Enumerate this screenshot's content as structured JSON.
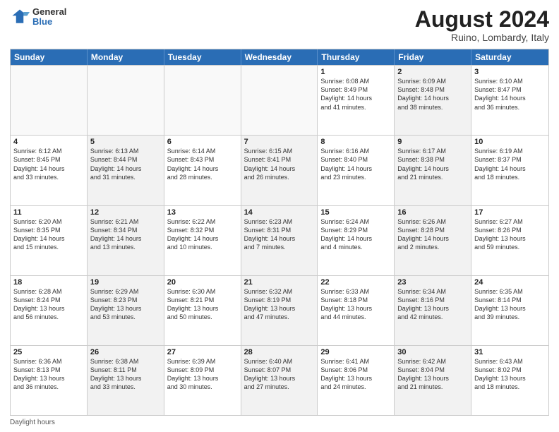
{
  "header": {
    "logo_general": "General",
    "logo_blue": "Blue",
    "main_title": "August 2024",
    "subtitle": "Ruino, Lombardy, Italy"
  },
  "calendar": {
    "days_of_week": [
      "Sunday",
      "Monday",
      "Tuesday",
      "Wednesday",
      "Thursday",
      "Friday",
      "Saturday"
    ],
    "weeks": [
      [
        {
          "day": "",
          "info": "",
          "shaded": false,
          "empty": true
        },
        {
          "day": "",
          "info": "",
          "shaded": false,
          "empty": true
        },
        {
          "day": "",
          "info": "",
          "shaded": false,
          "empty": true
        },
        {
          "day": "",
          "info": "",
          "shaded": false,
          "empty": true
        },
        {
          "day": "1",
          "info": "Sunrise: 6:08 AM\nSunset: 8:49 PM\nDaylight: 14 hours\nand 41 minutes.",
          "shaded": false,
          "empty": false
        },
        {
          "day": "2",
          "info": "Sunrise: 6:09 AM\nSunset: 8:48 PM\nDaylight: 14 hours\nand 38 minutes.",
          "shaded": true,
          "empty": false
        },
        {
          "day": "3",
          "info": "Sunrise: 6:10 AM\nSunset: 8:47 PM\nDaylight: 14 hours\nand 36 minutes.",
          "shaded": false,
          "empty": false
        }
      ],
      [
        {
          "day": "4",
          "info": "Sunrise: 6:12 AM\nSunset: 8:45 PM\nDaylight: 14 hours\nand 33 minutes.",
          "shaded": false,
          "empty": false
        },
        {
          "day": "5",
          "info": "Sunrise: 6:13 AM\nSunset: 8:44 PM\nDaylight: 14 hours\nand 31 minutes.",
          "shaded": true,
          "empty": false
        },
        {
          "day": "6",
          "info": "Sunrise: 6:14 AM\nSunset: 8:43 PM\nDaylight: 14 hours\nand 28 minutes.",
          "shaded": false,
          "empty": false
        },
        {
          "day": "7",
          "info": "Sunrise: 6:15 AM\nSunset: 8:41 PM\nDaylight: 14 hours\nand 26 minutes.",
          "shaded": true,
          "empty": false
        },
        {
          "day": "8",
          "info": "Sunrise: 6:16 AM\nSunset: 8:40 PM\nDaylight: 14 hours\nand 23 minutes.",
          "shaded": false,
          "empty": false
        },
        {
          "day": "9",
          "info": "Sunrise: 6:17 AM\nSunset: 8:38 PM\nDaylight: 14 hours\nand 21 minutes.",
          "shaded": true,
          "empty": false
        },
        {
          "day": "10",
          "info": "Sunrise: 6:19 AM\nSunset: 8:37 PM\nDaylight: 14 hours\nand 18 minutes.",
          "shaded": false,
          "empty": false
        }
      ],
      [
        {
          "day": "11",
          "info": "Sunrise: 6:20 AM\nSunset: 8:35 PM\nDaylight: 14 hours\nand 15 minutes.",
          "shaded": false,
          "empty": false
        },
        {
          "day": "12",
          "info": "Sunrise: 6:21 AM\nSunset: 8:34 PM\nDaylight: 14 hours\nand 13 minutes.",
          "shaded": true,
          "empty": false
        },
        {
          "day": "13",
          "info": "Sunrise: 6:22 AM\nSunset: 8:32 PM\nDaylight: 14 hours\nand 10 minutes.",
          "shaded": false,
          "empty": false
        },
        {
          "day": "14",
          "info": "Sunrise: 6:23 AM\nSunset: 8:31 PM\nDaylight: 14 hours\nand 7 minutes.",
          "shaded": true,
          "empty": false
        },
        {
          "day": "15",
          "info": "Sunrise: 6:24 AM\nSunset: 8:29 PM\nDaylight: 14 hours\nand 4 minutes.",
          "shaded": false,
          "empty": false
        },
        {
          "day": "16",
          "info": "Sunrise: 6:26 AM\nSunset: 8:28 PM\nDaylight: 14 hours\nand 2 minutes.",
          "shaded": true,
          "empty": false
        },
        {
          "day": "17",
          "info": "Sunrise: 6:27 AM\nSunset: 8:26 PM\nDaylight: 13 hours\nand 59 minutes.",
          "shaded": false,
          "empty": false
        }
      ],
      [
        {
          "day": "18",
          "info": "Sunrise: 6:28 AM\nSunset: 8:24 PM\nDaylight: 13 hours\nand 56 minutes.",
          "shaded": false,
          "empty": false
        },
        {
          "day": "19",
          "info": "Sunrise: 6:29 AM\nSunset: 8:23 PM\nDaylight: 13 hours\nand 53 minutes.",
          "shaded": true,
          "empty": false
        },
        {
          "day": "20",
          "info": "Sunrise: 6:30 AM\nSunset: 8:21 PM\nDaylight: 13 hours\nand 50 minutes.",
          "shaded": false,
          "empty": false
        },
        {
          "day": "21",
          "info": "Sunrise: 6:32 AM\nSunset: 8:19 PM\nDaylight: 13 hours\nand 47 minutes.",
          "shaded": true,
          "empty": false
        },
        {
          "day": "22",
          "info": "Sunrise: 6:33 AM\nSunset: 8:18 PM\nDaylight: 13 hours\nand 44 minutes.",
          "shaded": false,
          "empty": false
        },
        {
          "day": "23",
          "info": "Sunrise: 6:34 AM\nSunset: 8:16 PM\nDaylight: 13 hours\nand 42 minutes.",
          "shaded": true,
          "empty": false
        },
        {
          "day": "24",
          "info": "Sunrise: 6:35 AM\nSunset: 8:14 PM\nDaylight: 13 hours\nand 39 minutes.",
          "shaded": false,
          "empty": false
        }
      ],
      [
        {
          "day": "25",
          "info": "Sunrise: 6:36 AM\nSunset: 8:13 PM\nDaylight: 13 hours\nand 36 minutes.",
          "shaded": false,
          "empty": false
        },
        {
          "day": "26",
          "info": "Sunrise: 6:38 AM\nSunset: 8:11 PM\nDaylight: 13 hours\nand 33 minutes.",
          "shaded": true,
          "empty": false
        },
        {
          "day": "27",
          "info": "Sunrise: 6:39 AM\nSunset: 8:09 PM\nDaylight: 13 hours\nand 30 minutes.",
          "shaded": false,
          "empty": false
        },
        {
          "day": "28",
          "info": "Sunrise: 6:40 AM\nSunset: 8:07 PM\nDaylight: 13 hours\nand 27 minutes.",
          "shaded": true,
          "empty": false
        },
        {
          "day": "29",
          "info": "Sunrise: 6:41 AM\nSunset: 8:06 PM\nDaylight: 13 hours\nand 24 minutes.",
          "shaded": false,
          "empty": false
        },
        {
          "day": "30",
          "info": "Sunrise: 6:42 AM\nSunset: 8:04 PM\nDaylight: 13 hours\nand 21 minutes.",
          "shaded": true,
          "empty": false
        },
        {
          "day": "31",
          "info": "Sunrise: 6:43 AM\nSunset: 8:02 PM\nDaylight: 13 hours\nand 18 minutes.",
          "shaded": false,
          "empty": false
        }
      ]
    ]
  },
  "footer": {
    "note": "Daylight hours"
  }
}
